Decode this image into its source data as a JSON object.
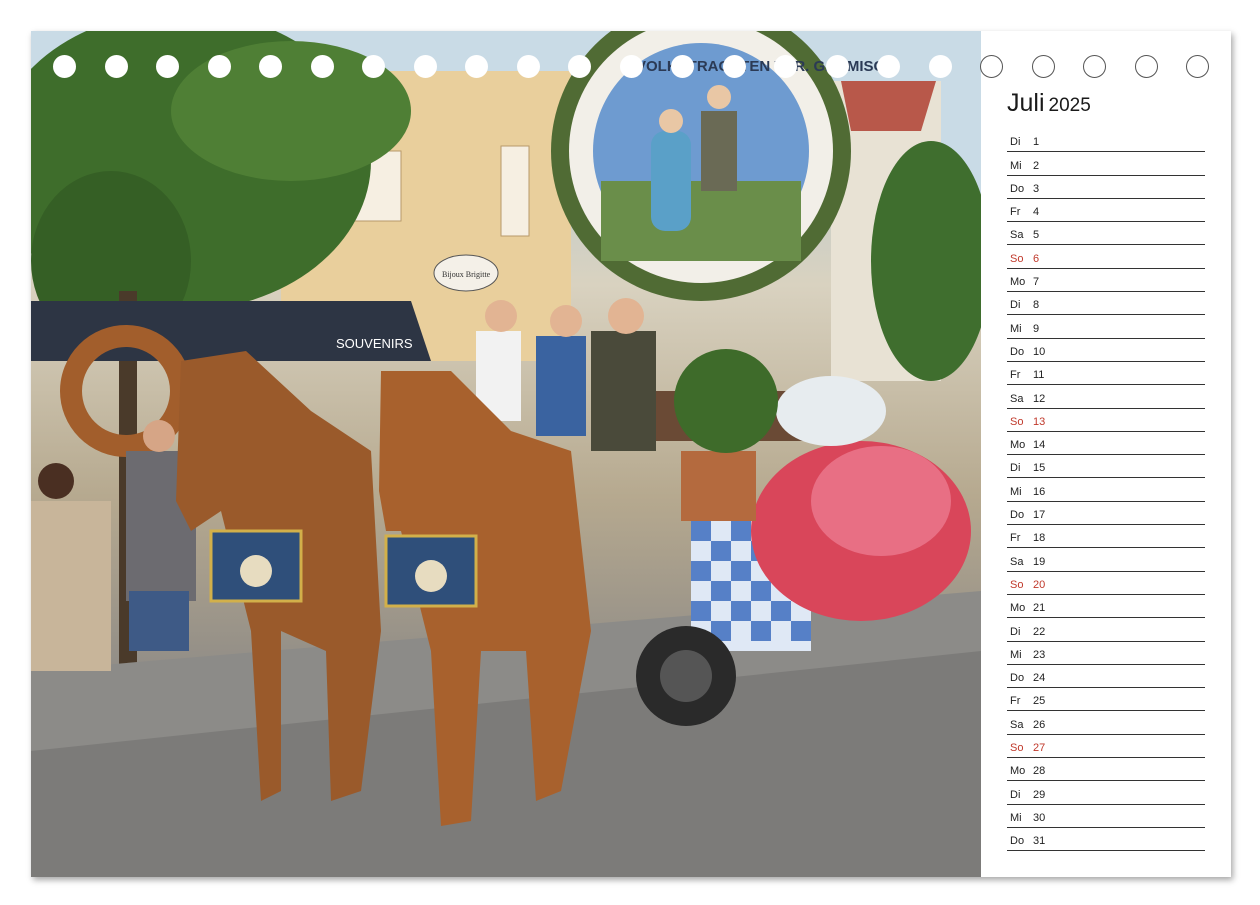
{
  "calendar": {
    "month": "Juli",
    "year": "2025",
    "days": [
      {
        "dow": "Di",
        "num": "1"
      },
      {
        "dow": "Mi",
        "num": "2"
      },
      {
        "dow": "Do",
        "num": "3"
      },
      {
        "dow": "Fr",
        "num": "4"
      },
      {
        "dow": "Sa",
        "num": "5"
      },
      {
        "dow": "So",
        "num": "6",
        "sunday": true
      },
      {
        "dow": "Mo",
        "num": "7"
      },
      {
        "dow": "Di",
        "num": "8"
      },
      {
        "dow": "Mi",
        "num": "9"
      },
      {
        "dow": "Do",
        "num": "10"
      },
      {
        "dow": "Fr",
        "num": "11"
      },
      {
        "dow": "Sa",
        "num": "12"
      },
      {
        "dow": "So",
        "num": "13",
        "sunday": true
      },
      {
        "dow": "Mo",
        "num": "14"
      },
      {
        "dow": "Di",
        "num": "15"
      },
      {
        "dow": "Mi",
        "num": "16"
      },
      {
        "dow": "Do",
        "num": "17"
      },
      {
        "dow": "Fr",
        "num": "18"
      },
      {
        "dow": "Sa",
        "num": "19"
      },
      {
        "dow": "So",
        "num": "20",
        "sunday": true
      },
      {
        "dow": "Mo",
        "num": "21"
      },
      {
        "dow": "Di",
        "num": "22"
      },
      {
        "dow": "Mi",
        "num": "23"
      },
      {
        "dow": "Do",
        "num": "24"
      },
      {
        "dow": "Fr",
        "num": "25"
      },
      {
        "dow": "Sa",
        "num": "26"
      },
      {
        "dow": "So",
        "num": "27",
        "sunday": true
      },
      {
        "dow": "Mo",
        "num": "28"
      },
      {
        "dow": "Di",
        "num": "29"
      },
      {
        "dow": "Mi",
        "num": "30"
      },
      {
        "dow": "Do",
        "num": "31"
      }
    ]
  },
  "photo": {
    "sign_text": "VOLKSTRACHTEN VER. GARMISCH",
    "shop_sign": "Bijoux Brigitte",
    "awning_text": "SOUVENIRS"
  },
  "colors": {
    "sunday": "#c0392b",
    "text": "#222222",
    "rule": "#333333"
  }
}
